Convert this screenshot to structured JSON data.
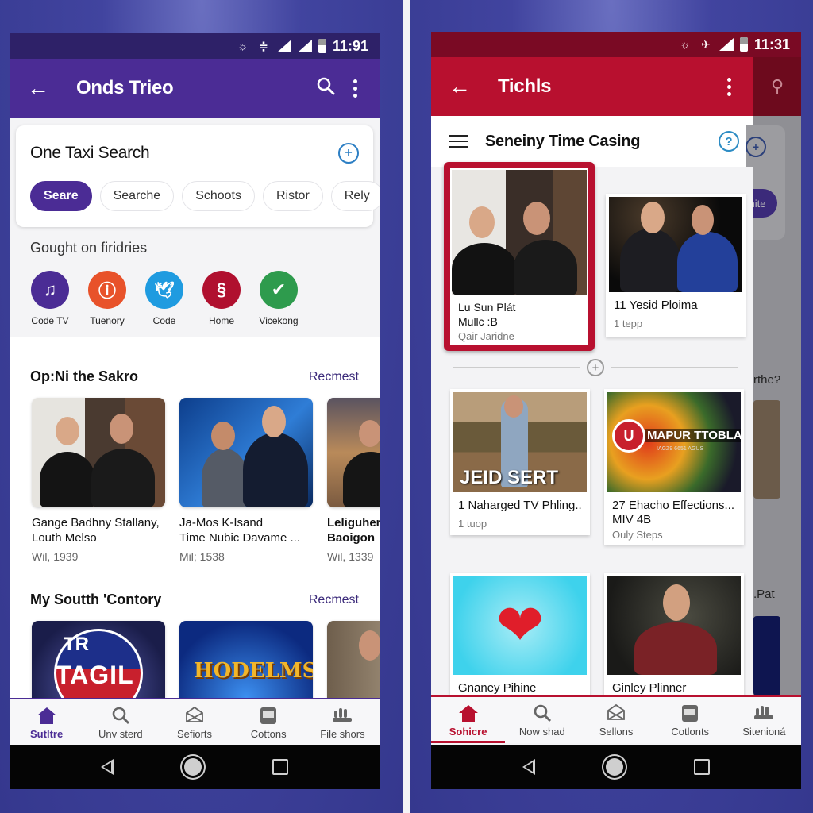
{
  "left_phone": {
    "status": {
      "time": "11:91"
    },
    "appbar": {
      "title": "Onds Trieo"
    },
    "search_card": {
      "title": "One Taxi Search",
      "chips": [
        {
          "label": "Seare",
          "active": true
        },
        {
          "label": "Searche",
          "active": false
        },
        {
          "label": "Schoots",
          "active": false
        },
        {
          "label": "Ristor",
          "active": false
        },
        {
          "label": "Rely",
          "active": false
        }
      ]
    },
    "apps_section": {
      "label": "Gought on firidries",
      "apps": [
        {
          "label": "Code TV",
          "icon": "music-note-icon",
          "glyph": "♫",
          "color": "#4b2c95"
        },
        {
          "label": "Tuenory",
          "icon": "info-ring-icon",
          "glyph": "ⓘ",
          "color": "#e8522a"
        },
        {
          "label": "Code",
          "icon": "bird-icon",
          "glyph": "🕊",
          "color": "#1f9be0"
        },
        {
          "label": "Home",
          "icon": "script-s-icon",
          "glyph": "§",
          "color": "#b0102f"
        },
        {
          "label": "Vicekong",
          "icon": "check-icon",
          "glyph": "✔",
          "color": "#2e9b4d"
        }
      ]
    },
    "section1": {
      "title": "Op:Ni the Sakro",
      "link": "Recmest",
      "items": [
        {
          "title_line1": "Gange Badhny Stallany,",
          "title_line2": "Louth Melso",
          "sub": "Wil, 1939"
        },
        {
          "title_line1": "Ja-Mos K-Isand",
          "title_line2": "Time Nubic Davame ...",
          "sub": "Mil; 1538"
        },
        {
          "title_line1": "Leliguhere",
          "title_line2": "Baoigon",
          "sub": "Wil, 1339"
        }
      ]
    },
    "section2": {
      "title": "My Soutth 'Contory",
      "link": "Recmest",
      "items": [
        {
          "thumb_text_top": "TR",
          "thumb_text": "TAGIL"
        },
        {
          "thumb_text": "HODELMS"
        },
        {
          "thumb_text": ""
        }
      ]
    },
    "bottom_nav": [
      {
        "label": "Sutltre",
        "icon": "home-icon",
        "glyph": "⌂",
        "active": true
      },
      {
        "label": "Unv sterd",
        "icon": "search-icon",
        "glyph": "⚲",
        "active": false
      },
      {
        "label": "Sefiorts",
        "icon": "envelope-icon",
        "glyph": "✉",
        "active": false
      },
      {
        "label": "Cottons",
        "icon": "calendar-icon",
        "glyph": "▦",
        "active": false
      },
      {
        "label": "File shors",
        "icon": "group-icon",
        "glyph": "⚇",
        "active": false
      }
    ]
  },
  "right_phone": {
    "status": {
      "time": "11:31"
    },
    "appbar": {
      "title": "Tichls"
    },
    "sub_header": {
      "title": "Seneiny Time Casing"
    },
    "grid": [
      {
        "title_line1": "Lu Sun Plát",
        "title_line2": "Mullc :B",
        "sub": "Qair Jaridne",
        "selected": true
      },
      {
        "title_line1": "11 Yesid Ploima",
        "title_line2": "",
        "sub": "1 tepp",
        "selected": false
      },
      {
        "title_line1": "1 Naharged TV Phling..",
        "title_line2": "",
        "sub": "1 tuop",
        "thumb_text": "JEID SERT",
        "selected": false
      },
      {
        "title_line1": "27 Ehacho Effections...",
        "title_line2": "MIV 4B",
        "sub": "Ouly Steps",
        "thumb_text": "MAPUR TTOBLA",
        "thumb_sub": "IAGZ9 6651 AGUS",
        "selected": false
      },
      {
        "title_line1": "Gnaney Pihine",
        "title_line2": "",
        "sub": "",
        "selected": false
      },
      {
        "title_line1": "Ginley Plinner",
        "title_line2": "",
        "sub": "",
        "selected": false
      }
    ],
    "overlay": {
      "chip_label": "nite",
      "text1": "rthe?",
      "text2": ".Pat"
    },
    "bottom_nav": [
      {
        "label": "Sohicre",
        "icon": "home-icon",
        "glyph": "⌂",
        "active": true
      },
      {
        "label": "Now shad",
        "icon": "search-icon",
        "glyph": "⚲",
        "active": false
      },
      {
        "label": "Sellons",
        "icon": "envelope-icon",
        "glyph": "✉",
        "active": false
      },
      {
        "label": "Cotlonts",
        "icon": "calendar-icon",
        "glyph": "▦",
        "active": false
      },
      {
        "label": "Sitenioná",
        "icon": "group-icon",
        "glyph": "⚇",
        "active": false
      }
    ]
  },
  "colors": {
    "left_primary": "#4b2c95",
    "right_primary": "#b8102f",
    "background": "#3d3f9a"
  }
}
